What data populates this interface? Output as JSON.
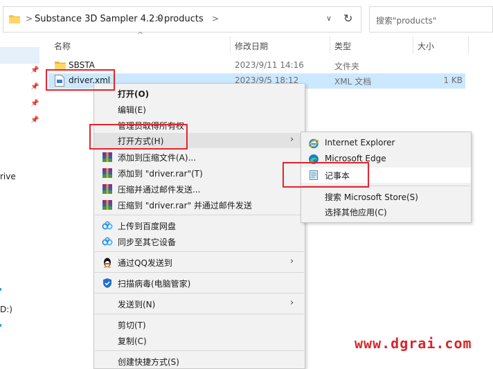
{
  "address": {
    "crumbs": [
      "Substance 3D Sampler 4.2.0",
      "products"
    ],
    "separator": ">",
    "dropdown_glyph": "∨",
    "refresh_glyph": "↻",
    "search_placeholder": "搜索\"products\""
  },
  "nav": {
    "fragments": [
      "rive",
      "D:)"
    ]
  },
  "columns": [
    "名称",
    "修改日期",
    "类型",
    "大小"
  ],
  "files": [
    {
      "name": "SBSTA",
      "date": "2023/9/11 14:16",
      "type": "文件夹",
      "size": "",
      "icon": "folder-icon"
    },
    {
      "name": "driver.xml",
      "date": "2023/9/5 18:12",
      "type": "XML 文档",
      "size": "1 KB",
      "icon": "xml-file-icon"
    }
  ],
  "context_menu": {
    "items": [
      {
        "label": "打开(O)",
        "bold": true,
        "icon": ""
      },
      {
        "label": "编辑(E)",
        "icon": ""
      },
      {
        "label": "管理员取得所有权",
        "icon": ""
      },
      {
        "label": "打开方式(H)",
        "icon": "",
        "submenu": true
      },
      {
        "label": "添加到压缩文件(A)...",
        "icon": "winrar-icon"
      },
      {
        "label": "添加到 \"driver.rar\"(T)",
        "icon": "winrar-icon"
      },
      {
        "label": "压缩并通过邮件发送...",
        "icon": "winrar-icon"
      },
      {
        "label": "压缩到 \"driver.rar\" 并通过邮件发送",
        "icon": "winrar-icon"
      },
      {
        "label": "上传到百度网盘",
        "icon": "baidu-cloud-icon"
      },
      {
        "label": "同步至其它设备",
        "icon": "baidu-cloud-icon"
      },
      {
        "label": "通过QQ发送到",
        "icon": "qq-penguin-icon",
        "submenu": true
      },
      {
        "label": "扫描病毒(电脑管家)",
        "icon": "shield-icon"
      },
      {
        "label": "发送到(N)",
        "icon": "",
        "submenu": true
      },
      {
        "label": "剪切(T)",
        "icon": ""
      },
      {
        "label": "复制(C)",
        "icon": ""
      },
      {
        "label": "创建快捷方式(S)",
        "icon": ""
      }
    ],
    "arrow_glyph": "›"
  },
  "submenu": {
    "items": [
      {
        "label": "Internet Explorer",
        "icon": "internet-explorer-icon"
      },
      {
        "label": "Microsoft Edge",
        "icon": "microsoft-edge-icon"
      },
      {
        "label": "记事本",
        "icon": "notepad-icon"
      },
      {
        "label": "搜索 Microsoft Store(S)",
        "icon": ""
      },
      {
        "label": "选择其他应用(C)",
        "icon": ""
      }
    ]
  },
  "watermark": "www.dgrai.com",
  "colors": {
    "selection": "#cce8ff",
    "highlight_box": "#e8222a",
    "watermark": "#d9252a"
  }
}
